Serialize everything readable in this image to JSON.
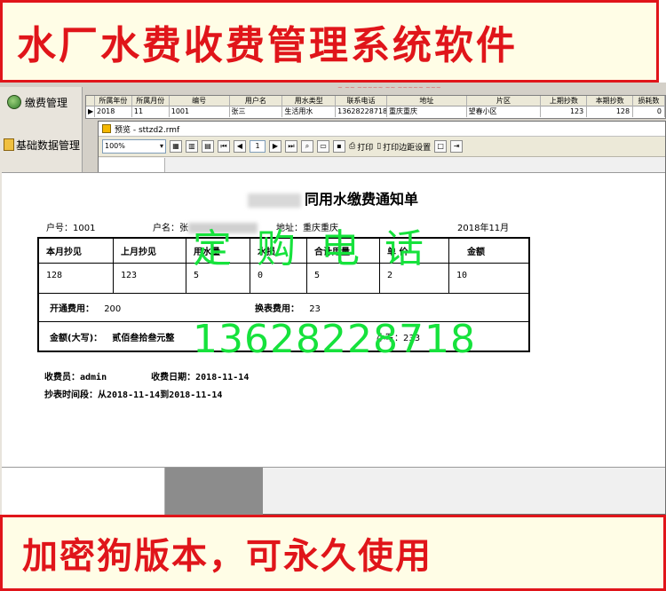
{
  "top_banner": {
    "text": "水厂水费收费管理系统软件"
  },
  "sidebar": {
    "items": [
      {
        "label": "缴费管理"
      },
      {
        "label": "基础数据管理"
      }
    ]
  },
  "grid": {
    "columns": [
      "所属年份",
      "所属月份",
      "编号",
      "用户名",
      "用水类型",
      "联系电话",
      "地址",
      "片区",
      "上期抄数",
      "本期抄数",
      "损耗数"
    ],
    "row": [
      "2018",
      "11",
      "1001",
      "张三",
      "生活用水",
      "13628228718",
      "重庆重庆",
      "望春小区",
      "123",
      "128",
      "0"
    ]
  },
  "preview": {
    "title": "预览 - sttzd2.rmf",
    "zoom": "100%",
    "page": "1",
    "print_label": "打印",
    "margin_label": "打印边距设置"
  },
  "notice": {
    "title": "同用水缴费通知单",
    "account_label": "户号：",
    "account_value": "1001",
    "name_label": "户名：张",
    "address_label": "地址：",
    "address_value": "重庆重庆",
    "date": "2018年11月",
    "headers": [
      "本月抄见",
      "上月抄见",
      "用水量",
      "水损",
      "合计用量",
      "单  价",
      "金额"
    ],
    "values": [
      "128",
      "123",
      "5",
      "0",
      "5",
      "2",
      "10"
    ],
    "open_fee_label": "开通费用：",
    "open_fee_value": "200",
    "swap_fee_label": "换表费用：",
    "swap_fee_value": "23",
    "total_upper_label": "金额(大写)：",
    "total_upper_value": "贰佰叁拾叁元整",
    "total_lower_label": "小写：",
    "total_lower_value": "233",
    "cashier_label": "收费员：",
    "cashier_value": "admin",
    "pay_date_label": "收费日期：",
    "pay_date_value": "2018-11-14",
    "period_label": "抄表时间段：",
    "period_value": "从2018-11-14到2018-11-14"
  },
  "watermark": {
    "line1": "定购电话",
    "line2": "13628228718"
  },
  "bottom_banner": {
    "text": "加密狗版本，可永久使用"
  },
  "colors": {
    "banner_red": "#e0151a",
    "watermark_green": "#16e23c",
    "window_bg": "#d4d0c8"
  }
}
